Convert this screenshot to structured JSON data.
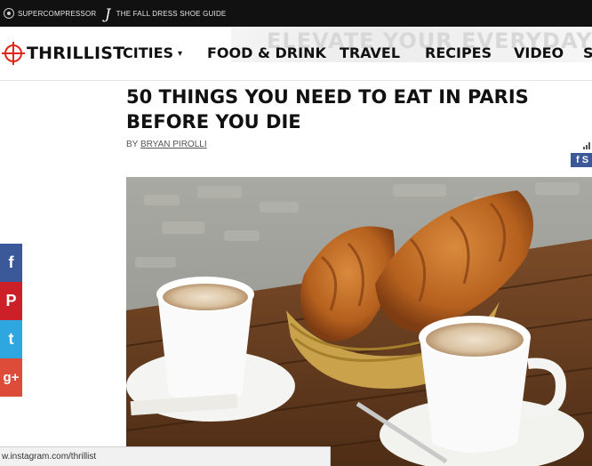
{
  "topbar": {
    "links": [
      {
        "label": "SUPERCOMPRESSOR",
        "icon": "supercompressor-logo-icon"
      },
      {
        "label": "THE FALL DRESS SHOE GUIDE",
        "icon": "j-logo-icon"
      }
    ]
  },
  "ad": {
    "text": "ELEVATE YOUR EVERYDAY"
  },
  "brand": {
    "name": "THRILLIST",
    "accent": "#e1261c"
  },
  "nav": {
    "items": [
      "CITIES",
      "FOOD & DRINK",
      "TRAVEL",
      "RECIPES",
      "VIDEO",
      "S"
    ],
    "cities_caret": "▾"
  },
  "article": {
    "title_line1": "50 THINGS YOU NEED TO EAT IN PARIS",
    "title_line2": "BEFORE YOU DIE",
    "byline_prefix": "BY ",
    "author": "BRYAN PIROLLI"
  },
  "share": {
    "facebook_mini_label": "f S",
    "buttons": [
      {
        "network": "facebook",
        "glyph": "f",
        "color": "#3b5998"
      },
      {
        "network": "pinterest",
        "glyph": "P",
        "color": "#cb2027"
      },
      {
        "network": "twitter",
        "glyph": "t",
        "color": "#2ea7e0"
      },
      {
        "network": "google-plus",
        "glyph": "g+",
        "color": "#dd4b39"
      }
    ]
  },
  "hero": {
    "alt": "croissants-and-coffee-photo"
  },
  "status": {
    "url": "w.instagram.com/thrillist"
  }
}
